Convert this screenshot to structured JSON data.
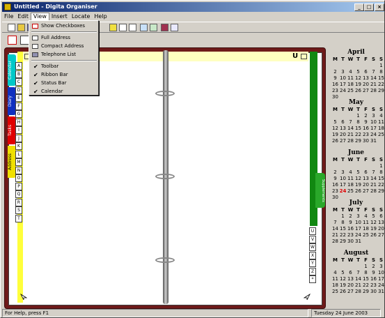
{
  "window": {
    "title": "Untitled - Digita Organiser"
  },
  "titlebar_buttons": {
    "minimize": "_",
    "maximize": "□",
    "close": "×"
  },
  "menu": [
    "File",
    "Edit",
    "View",
    "Insert",
    "Locate",
    "Help"
  ],
  "view_menu": {
    "items": [
      {
        "label": "Show Checkboxes",
        "icon": "checkbox-icon"
      },
      {
        "label": "Full Address",
        "icon": "full-address-icon"
      },
      {
        "label": "Compact Address",
        "icon": "compact-address-icon"
      },
      {
        "label": "Telephone List",
        "icon": "telephone-list-icon"
      },
      {
        "label": "Toolbar",
        "checked": true
      },
      {
        "label": "Ribbon Bar",
        "checked": true
      },
      {
        "label": "Status Bar",
        "checked": true
      },
      {
        "label": "Calendar",
        "checked": true
      }
    ]
  },
  "section_tabs": [
    "Calendar",
    "Diary",
    "Tasks",
    "Address"
  ],
  "address_letters": [
    "A",
    "B",
    "C",
    "D",
    "E",
    "F",
    "G",
    "H",
    "I",
    "J",
    "K",
    "L",
    "M",
    "N",
    "O",
    "P",
    "Q",
    "R",
    "S",
    "T"
  ],
  "right_letters": [
    "U",
    "V",
    "W",
    "X",
    "Y",
    "Z",
    "*"
  ],
  "supplement_tab": "Supplements",
  "page_header": {
    "letter": "U"
  },
  "calendar": {
    "day_headers": [
      "M",
      "T",
      "W",
      "T",
      "F",
      "S",
      "S"
    ],
    "today": {
      "month": "June",
      "day": "24"
    },
    "months": [
      {
        "name": "April",
        "days": [
          "",
          "",
          "",
          "",
          "",
          "",
          "1",
          "2",
          "3",
          "4",
          "5",
          "6",
          "7",
          "8",
          "9",
          "10",
          "11",
          "12",
          "13",
          "14",
          "15",
          "16",
          "17",
          "18",
          "19",
          "20",
          "21",
          "22",
          "23",
          "24",
          "25",
          "26",
          "27",
          "28",
          "29",
          "30"
        ]
      },
      {
        "name": "May",
        "days": [
          "",
          "",
          "",
          "1",
          "2",
          "3",
          "4",
          "5",
          "6",
          "7",
          "8",
          "9",
          "10",
          "11",
          "12",
          "13",
          "14",
          "15",
          "16",
          "17",
          "18",
          "19",
          "20",
          "21",
          "22",
          "23",
          "24",
          "25",
          "26",
          "27",
          "28",
          "29",
          "30",
          "31"
        ]
      },
      {
        "name": "June",
        "days": [
          "",
          "",
          "",
          "",
          "",
          "",
          "1",
          "2",
          "3",
          "4",
          "5",
          "6",
          "7",
          "8",
          "9",
          "10",
          "11",
          "12",
          "13",
          "14",
          "15",
          "16",
          "17",
          "18",
          "19",
          "20",
          "21",
          "22",
          "23",
          "24",
          "25",
          "26",
          "27",
          "28",
          "29",
          "30"
        ]
      },
      {
        "name": "July",
        "days": [
          "",
          "1",
          "2",
          "3",
          "4",
          "5",
          "6",
          "7",
          "8",
          "9",
          "10",
          "11",
          "12",
          "13",
          "14",
          "15",
          "16",
          "17",
          "18",
          "19",
          "20",
          "21",
          "22",
          "23",
          "24",
          "25",
          "26",
          "27",
          "28",
          "29",
          "30",
          "31"
        ]
      },
      {
        "name": "August",
        "days": [
          "",
          "",
          "",
          "",
          "1",
          "2",
          "3",
          "4",
          "5",
          "6",
          "7",
          "8",
          "9",
          "10",
          "11",
          "12",
          "13",
          "14",
          "15",
          "16",
          "17",
          "18",
          "19",
          "20",
          "21",
          "22",
          "23",
          "24",
          "25",
          "26",
          "27",
          "28",
          "29",
          "30",
          "31"
        ]
      }
    ]
  },
  "status": {
    "help": "For Help, press F1",
    "date": "Tuesday 24 June 2003"
  },
  "colors": {
    "binder": "#6e1a1a",
    "calendar_tab": "#00c8c8",
    "diary_tab": "#1030c0",
    "tasks_tab": "#e00000",
    "address_tab": "#f0e000",
    "supplement_tab": "#2aa82a",
    "today": "#e00000"
  }
}
